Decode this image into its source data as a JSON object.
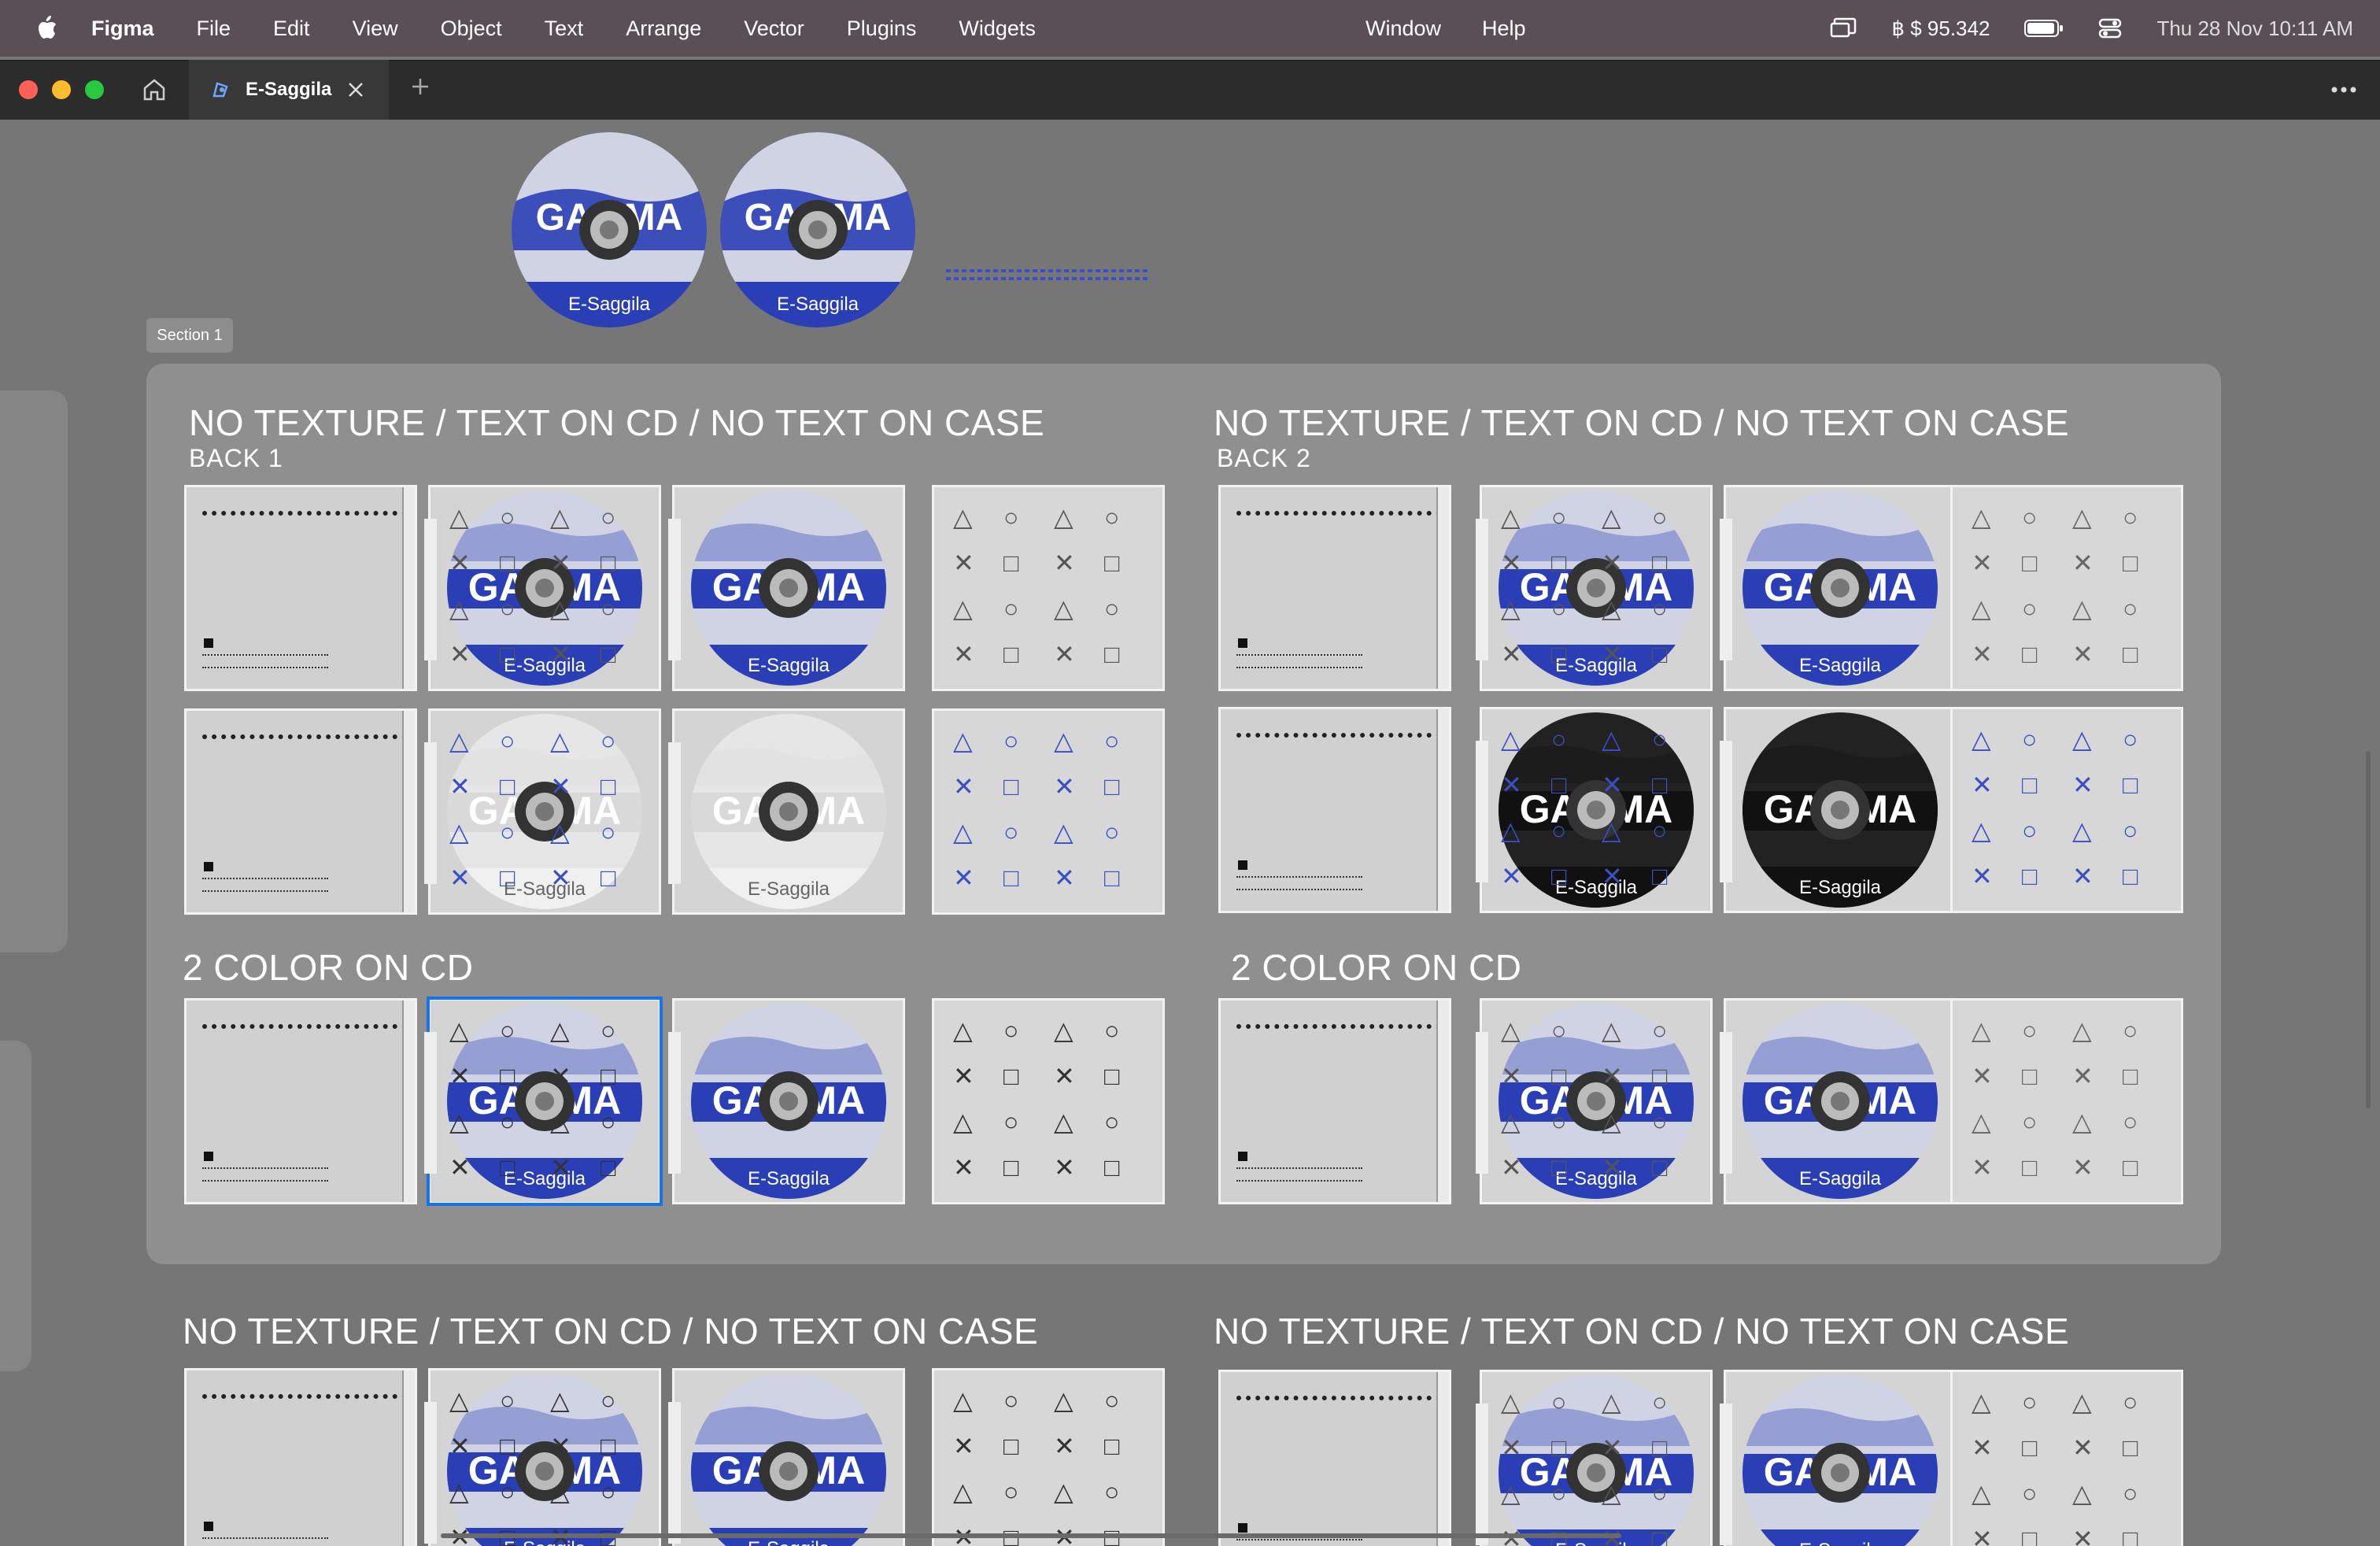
{
  "menubar": {
    "app": "Figma",
    "items": [
      "File",
      "Edit",
      "View",
      "Object",
      "Text",
      "Arrange",
      "Vector",
      "Plugins",
      "Widgets"
    ],
    "center": [
      "Window",
      "Help"
    ],
    "balance": "฿ $ 95.342",
    "datetime": "Thu 28 Nov  10:11 AM"
  },
  "tabs": {
    "active": "E-Saggila"
  },
  "canvas": {
    "section_label": "Section 1",
    "disc_label": "E-Saggila",
    "groups": [
      {
        "heading": "NO TEXTURE / TEXT ON CD / NO TEXT ON CASE",
        "sub": "BACK 1"
      },
      {
        "heading": "NO TEXTURE / TEXT ON CD / NO TEXT ON CASE",
        "sub": "BACK 2"
      },
      {
        "heading": "2 COLOR ON CD"
      },
      {
        "heading": "2 COLOR ON CD"
      },
      {
        "heading": "NO TEXTURE / TEXT ON CD / NO TEXT ON CASE"
      },
      {
        "heading": "NO TEXTURE / TEXT ON CD / NO TEXT ON CASE"
      }
    ]
  },
  "colors": {
    "accent": "#1a73e8",
    "disc_blue": "#2a3fb5",
    "canvas": "#767676"
  }
}
